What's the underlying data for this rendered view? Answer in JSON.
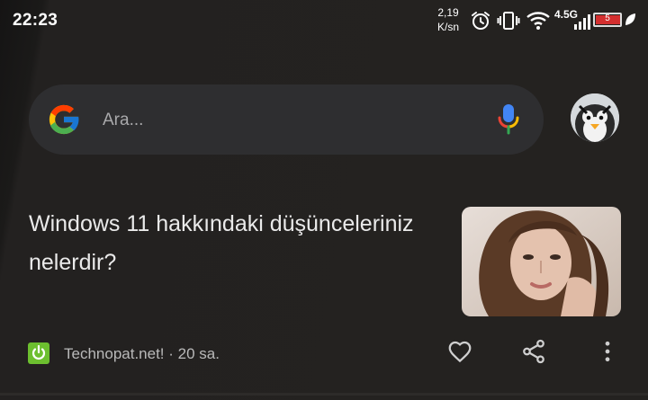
{
  "status_bar": {
    "time": "22:23",
    "net_speed_value": "2,19",
    "net_speed_unit": "K/sn",
    "network_type": "4.5G",
    "battery_level": "5",
    "icons": [
      "alarm-icon",
      "vibrate-icon",
      "wifi-icon",
      "signal-icon",
      "battery-icon",
      "leaf-icon"
    ]
  },
  "search": {
    "placeholder": "Ara...",
    "logo": "google-g-icon",
    "mic": "mic-icon"
  },
  "profile": {
    "avatar": "penguin-avatar"
  },
  "article": {
    "title": "Windows 11 hakkındaki düşünceleriniz nelerdir?",
    "source": "Technopat.net!",
    "age": "20 sa.",
    "source_meta": "Technopat.net! · 20 sa.",
    "actions": [
      "heart-icon",
      "share-icon",
      "more-vert-icon"
    ]
  },
  "colors": {
    "background": "#242220",
    "search_bg": "#2e2e30",
    "source_icon": "#6cbf2f",
    "battery_low": "#e53935"
  }
}
